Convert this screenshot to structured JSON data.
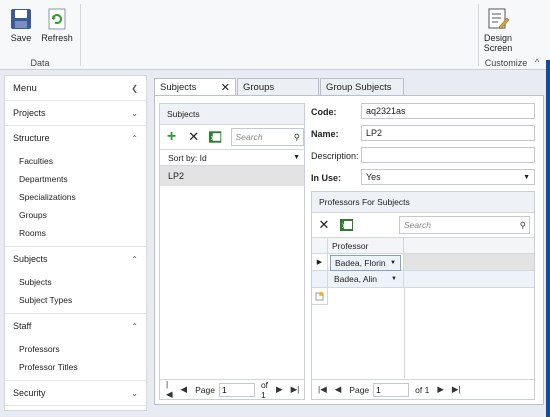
{
  "ribbon": {
    "save_label": "Save",
    "refresh_label": "Refresh",
    "data_group": "Data",
    "design_screen_label": "Design Screen",
    "customize_group": "Customize",
    "collapse_icon": "chevron-up"
  },
  "sidebar": {
    "title": "Menu",
    "sections": [
      {
        "label": "Projects",
        "items": []
      },
      {
        "label": "Structure",
        "items": [
          "Faculties",
          "Departments",
          "Specializations",
          "Groups",
          "Rooms"
        ]
      },
      {
        "label": "Subjects",
        "items": [
          "Subjects",
          "Subject Types"
        ]
      },
      {
        "label": "Staff",
        "items": [
          "Professors",
          "Professor Titles"
        ]
      },
      {
        "label": "Security",
        "items": []
      }
    ]
  },
  "tabs": [
    {
      "label": "Subjects",
      "active": true
    },
    {
      "label": "Groups",
      "active": false
    },
    {
      "label": "Group Subjects",
      "active": false
    }
  ],
  "subjects_panel": {
    "title": "Subjects",
    "search_placeholder": "Search",
    "sort_label": "Sort by: Id",
    "rows": [
      "LP2"
    ],
    "pager": {
      "page_label": "Page",
      "page_value": "1",
      "of_label": "of 1"
    }
  },
  "detail": {
    "code_label": "Code:",
    "code_value": "aq2321as",
    "name_label": "Name:",
    "name_value": "LP2",
    "description_label": "Description:",
    "description_value": "",
    "inuse_label": "In Use:",
    "inuse_value": "Yes"
  },
  "professors_panel": {
    "title": "Professors For Subjects",
    "search_placeholder": "Search",
    "column_header": "Professor",
    "rows": [
      "Badea, Florin",
      "Badea, Alin"
    ],
    "pager": {
      "page_label": "Page",
      "page_value": "1",
      "of_label": "of 1"
    }
  },
  "colors": {
    "accent": "#0a4fa1",
    "selected_row": "#e3e3e3",
    "add_icon": "#2f9e2f"
  }
}
